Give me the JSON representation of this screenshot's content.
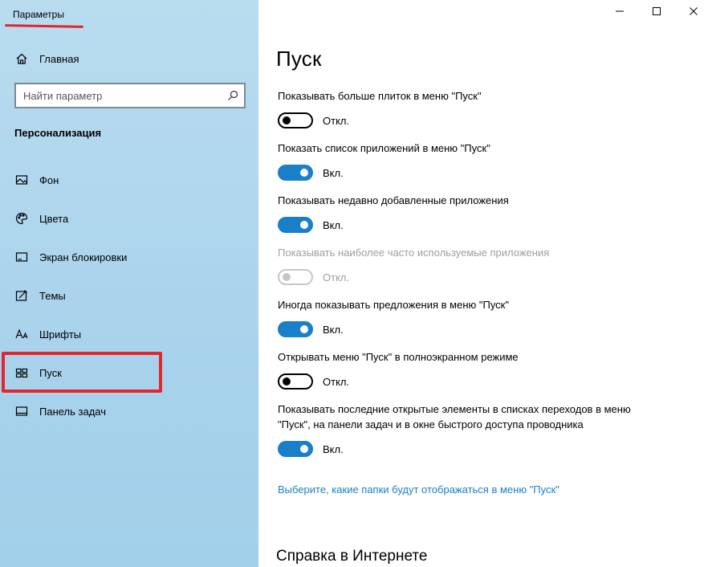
{
  "app": {
    "title": "Параметры"
  },
  "sidebar": {
    "home": {
      "label": "Главная",
      "icon": "home-icon"
    },
    "search": {
      "placeholder": "Найти параметр",
      "icon": "search-icon"
    },
    "section_heading": "Персонализация",
    "items": [
      {
        "label": "Фон",
        "icon": "image-icon",
        "selected": false
      },
      {
        "label": "Цвета",
        "icon": "palette-icon",
        "selected": false
      },
      {
        "label": "Экран блокировки",
        "icon": "lock-screen-icon",
        "selected": false
      },
      {
        "label": "Темы",
        "icon": "themes-icon",
        "selected": false
      },
      {
        "label": "Шрифты",
        "icon": "fonts-icon",
        "selected": false
      },
      {
        "label": "Пуск",
        "icon": "start-icon",
        "selected": true
      },
      {
        "label": "Панель задач",
        "icon": "taskbar-icon",
        "selected": false
      }
    ]
  },
  "window_controls": {
    "minimize": "minimize-icon",
    "maximize": "maximize-icon",
    "close": "close-icon"
  },
  "main": {
    "title": "Пуск",
    "settings": [
      {
        "label": "Показывать больше плиток в меню \"Пуск\"",
        "state": "Откл.",
        "on": false,
        "disabled": false
      },
      {
        "label": "Показать список приложений в меню \"Пуск\"",
        "state": "Вкл.",
        "on": true,
        "disabled": false
      },
      {
        "label": "Показывать недавно добавленные приложения",
        "state": "Вкл.",
        "on": true,
        "disabled": false
      },
      {
        "label": "Показывать наиболее часто используемые приложения",
        "state": "Откл.",
        "on": false,
        "disabled": true
      },
      {
        "label": "Иногда показывать предложения в меню \"Пуск\"",
        "state": "Вкл.",
        "on": true,
        "disabled": false
      },
      {
        "label": "Открывать меню \"Пуск\" в полноэкранном режиме",
        "state": "Откл.",
        "on": false,
        "disabled": false
      },
      {
        "label": "Показывать последние открытые элементы в списках переходов в меню \"Пуск\", на панели задач и в окне быстрого доступа проводника",
        "state": "Вкл.",
        "on": true,
        "disabled": false
      }
    ],
    "link": "Выберите, какие папки будут отображаться в меню \"Пуск\"",
    "help_heading": "Справка в Интернете"
  },
  "colors": {
    "accent": "#1a7fc9",
    "highlight": "#e3262b",
    "sidebar_bg": "#a9d3ec"
  }
}
